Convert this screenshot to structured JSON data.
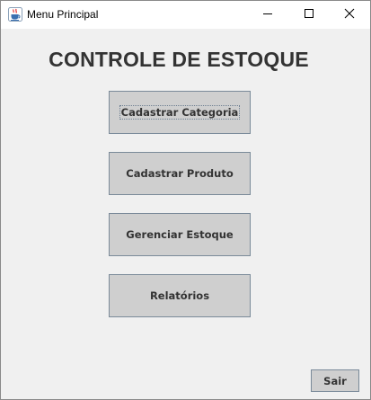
{
  "window": {
    "title": "Menu Principal",
    "icon": "java-cup-icon"
  },
  "titlebar_controls": {
    "minimize": "minimize-icon",
    "maximize": "maximize-icon",
    "close": "close-icon"
  },
  "main": {
    "heading": "CONTROLE DE ESTOQUE",
    "buttons": [
      {
        "label": "Cadastrar Categoria",
        "focused": true
      },
      {
        "label": "Cadastrar Produto"
      },
      {
        "label": "Gerenciar Estoque"
      },
      {
        "label": "Relatórios"
      }
    ],
    "exit_label": "Sair"
  },
  "colors": {
    "background": "#f0f0f0",
    "button_face": "#cfcfcf",
    "button_border": "#7a8a99",
    "text": "#333333"
  }
}
